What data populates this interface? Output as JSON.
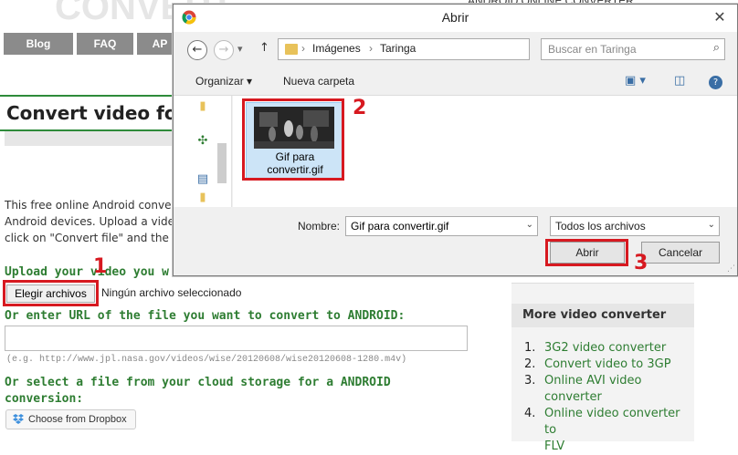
{
  "website": {
    "header_tagline": "ANDROID ONLINE CONVERTER",
    "nav": [
      "Blog",
      "FAQ",
      "AP"
    ],
    "title": "Convert video for",
    "intro_lines": [
      "This free online Android conver",
      "Android devices. Upload a video",
      "click on \"Convert file\" and the"
    ],
    "upload_heading": "Upload your video you w",
    "choose_button": "Elegir archivos",
    "no_file_text": "Ningún archivo seleccionado",
    "url_heading": "Or enter URL of the file you want to convert to ANDROID:",
    "url_example": "(e.g. http://www.jpl.nasa.gov/videos/wise/20120608/wise20120608-1280.m4v)",
    "cloud_heading_1": "Or select a file from your cloud storage for a ANDROID",
    "cloud_heading_2": "conversion:",
    "dropbox_button": "Choose from Dropbox",
    "sidebar": {
      "heading": "More video converter",
      "items": [
        {
          "num": "1.",
          "lines": [
            "3G2 video converter"
          ]
        },
        {
          "num": "2.",
          "lines": [
            "Convert video to 3GP"
          ]
        },
        {
          "num": "3.",
          "lines": [
            "Online AVI video",
            "converter"
          ]
        },
        {
          "num": "4.",
          "lines": [
            "Online video converter to",
            "FLV"
          ]
        }
      ]
    }
  },
  "dialog": {
    "title": "Abrir",
    "close": "✕",
    "path": [
      "Imágenes",
      "Taringa"
    ],
    "search_placeholder": "Buscar en Taringa",
    "organize": "Organizar ▾",
    "new_folder": "Nueva carpeta",
    "file": {
      "name_line1": "Gif para",
      "name_line2": "convertir.gif"
    },
    "name_label": "Nombre:",
    "name_value": "Gif para convertir.gif",
    "type_value": "Todos los archivos",
    "open_button": "Abrir",
    "cancel_button": "Cancelar"
  },
  "annotations": [
    "1",
    "2",
    "3"
  ],
  "colors": {
    "annotation": "#d71920",
    "link_green": "#2e7d32",
    "selection": "#cce4f7"
  }
}
